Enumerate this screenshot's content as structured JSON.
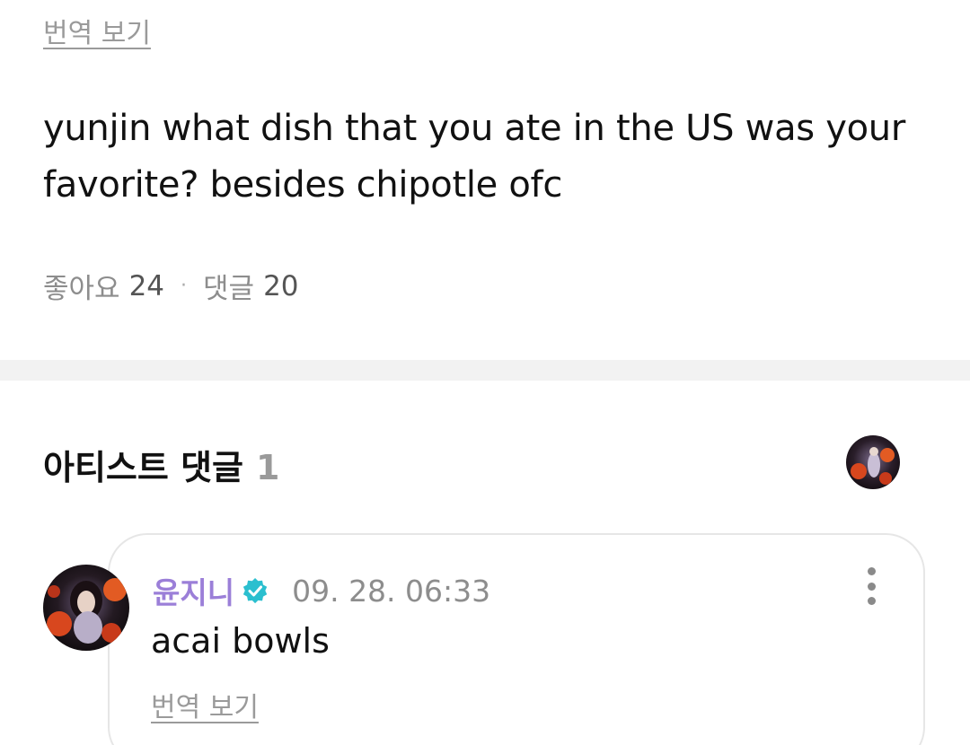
{
  "post": {
    "translate_label": "번역 보기",
    "body": "yunjin what dish that you ate in the US was your favorite? besides chipotle ofc",
    "likes_label": "좋아요",
    "likes_count": "24",
    "separator": "·",
    "comments_label": "댓글",
    "comments_count": "20"
  },
  "artist_comments": {
    "title": "아티스트 댓글",
    "count": "1",
    "comment": {
      "author": "윤지니",
      "timestamp": "09. 28. 06:33",
      "text": "acai bowls",
      "translate_label": "번역 보기"
    }
  },
  "colors": {
    "author_name": "#9b7fd8",
    "verified_badge": "#2bbfcf",
    "muted_text": "#8d8d8d"
  },
  "icons": {
    "verified": "verified-badge-icon",
    "more": "more-vertical-icon"
  }
}
